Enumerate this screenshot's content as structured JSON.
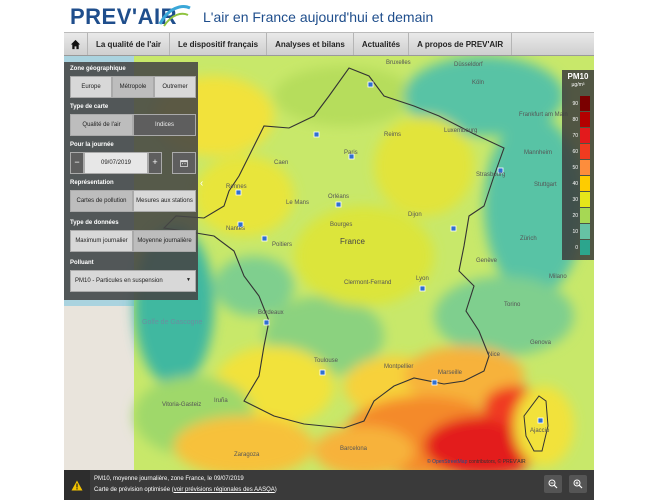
{
  "header": {
    "logo_text": "PREV'AIR",
    "tagline": "L'air en France aujourd'hui et demain"
  },
  "nav": {
    "home_icon": "home-icon",
    "items": [
      "La qualité de l'air",
      "Le dispositif français",
      "Analyses et bilans",
      "Actualités",
      "A propos de PREV'AIR"
    ]
  },
  "panel": {
    "zone_title": "Zone géographique",
    "zone_options": [
      "Europe",
      "Métropole",
      "Outremer"
    ],
    "zone_selected": "Métropole",
    "map_type_title": "Type de carte",
    "map_type_options": [
      "Qualité de l'air",
      "Indices"
    ],
    "day_title": "Pour la journée",
    "date_value": "09/07/2019",
    "minus_label": "−",
    "plus_label": "+",
    "calendar_icon": "calendar-icon",
    "representation_title": "Représentation",
    "representation_options": [
      "Cartes de pollution",
      "Mesures aux stations"
    ],
    "data_type_title": "Type de données",
    "data_type_options": [
      "Maximum journalier",
      "Moyenne journalière"
    ],
    "pollutant_title": "Polluant",
    "pollutant_value": "PM10 - Particules en suspension",
    "collapse_label": "‹"
  },
  "legend": {
    "title": "PM10",
    "unit": "µg/m³",
    "labels": [
      "90",
      "80",
      "70",
      "60",
      "50",
      "40",
      "30",
      "20",
      "10",
      "0"
    ],
    "colors": [
      "#7a0000",
      "#b30000",
      "#e31a1c",
      "#f03b20",
      "#fd8d3c",
      "#fecc00",
      "#e6e61a",
      "#a6d854",
      "#66c2a4",
      "#2ca58d"
    ]
  },
  "map_labels": [
    "Düsseldorf",
    "Köln",
    "Bruxelles",
    "Frankfurt am Main",
    "Luxembourg",
    "Paris",
    "Strasbourg",
    "Rennes",
    "Le Mans",
    "Orléans",
    "Nantes",
    "Poitiers",
    "France",
    "Dijon",
    "Genève",
    "Lyon",
    "Clermont-Ferrand",
    "Bordeaux",
    "Toulouse",
    "Montpellier",
    "Marseille",
    "Genova",
    "Vitoria-Gasteiz",
    "Barcelona",
    "Zaragoza",
    "Golfe de Gascogne",
    "Iruña",
    "Bourges",
    "Caen",
    "Reims",
    "Mannheim",
    "Stuttgart",
    "Zürich",
    "Torino",
    "Milano",
    "Nice",
    "Ajaccio"
  ],
  "attribution": {
    "osm": "© OpenStreetMap",
    "rest": " contributors, © PREV'AIR"
  },
  "bottom": {
    "warning_icon": "warning-icon",
    "line1": "PM10, moyenne journalière, zone France, le 09/07/2019",
    "line2_prefix": "Carte de prévision optimisée (",
    "line2_link": "voir prévisions régionales des AASQA",
    "line2_suffix": ")",
    "zoom_out_icon": "zoom-out-icon",
    "zoom_in_icon": "zoom-in-icon"
  }
}
